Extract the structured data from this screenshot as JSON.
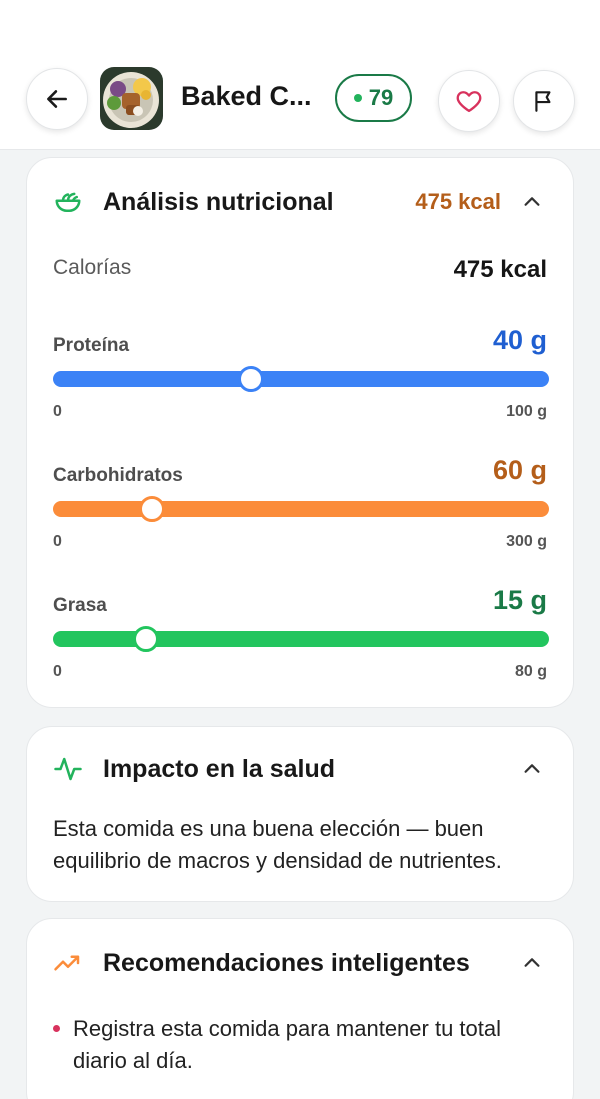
{
  "header": {
    "back_icon": "arrow-left-icon",
    "title": "Baked C...",
    "score": "79",
    "favorite_icon": "heart-icon",
    "report_icon": "flag-icon",
    "colors": {
      "score": "#1a7a47",
      "heart": "#d8325d"
    }
  },
  "nutrition": {
    "title": "Análisis nutricional",
    "header_kcal": "475 kcal",
    "calories_label": "Calorías",
    "calories_value": "475 kcal",
    "macros": [
      {
        "label": "Proteína",
        "value": "40 g",
        "amount": 40,
        "min_label": "0",
        "max_label": "100 g",
        "max": 100,
        "color": "#3b82f6",
        "value_color": "#1f5fd1"
      },
      {
        "label": "Carbohidratos",
        "value": "60 g",
        "amount": 60,
        "min_label": "0",
        "max_label": "300 g",
        "max": 300,
        "color": "#fb8c3a",
        "value_color": "#b45e1a"
      },
      {
        "label": "Grasa",
        "value": "15 g",
        "amount": 15,
        "min_label": "0",
        "max_label": "80 g",
        "max": 80,
        "color": "#22c55e",
        "value_color": "#1a7a47"
      }
    ]
  },
  "health": {
    "title": "Impacto en la salud",
    "text": "Esta comida es una buena elección — buen equilibrio de macros y densidad de nutrientes."
  },
  "recommendations": {
    "title": "Recomendaciones inteligentes",
    "items": [
      "Registra esta comida para mantener tu total diario al día."
    ]
  }
}
